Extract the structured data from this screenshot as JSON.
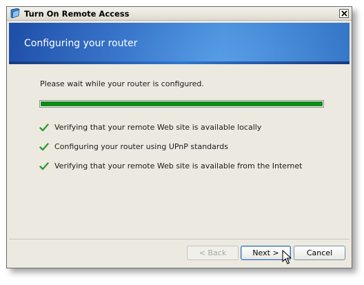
{
  "window": {
    "title": "Turn On Remote Access"
  },
  "banner": {
    "title": "Configuring your router"
  },
  "content": {
    "status": "Please wait while your router is configured.",
    "progress_fraction": 1.0,
    "steps": [
      {
        "label": "Verifying that your remote Web site is available locally",
        "status": "done"
      },
      {
        "label": "Configuring your router using UPnP standards",
        "status": "done"
      },
      {
        "label": "Verifying that your remote Web site is available from the Internet",
        "status": "done"
      }
    ]
  },
  "buttons": {
    "back": {
      "label": "< Back",
      "enabled": false
    },
    "next": {
      "label": "Next >",
      "enabled": true
    },
    "cancel": {
      "label": "Cancel",
      "enabled": true
    }
  },
  "colors": {
    "banner": "#2a67c2",
    "progress_fill": "#118a18",
    "check": "#2e9a2e"
  },
  "icons": {
    "app": "home-server-icon",
    "close": "close-icon",
    "check": "check-icon",
    "cursor": "mouse-pointer-icon"
  }
}
